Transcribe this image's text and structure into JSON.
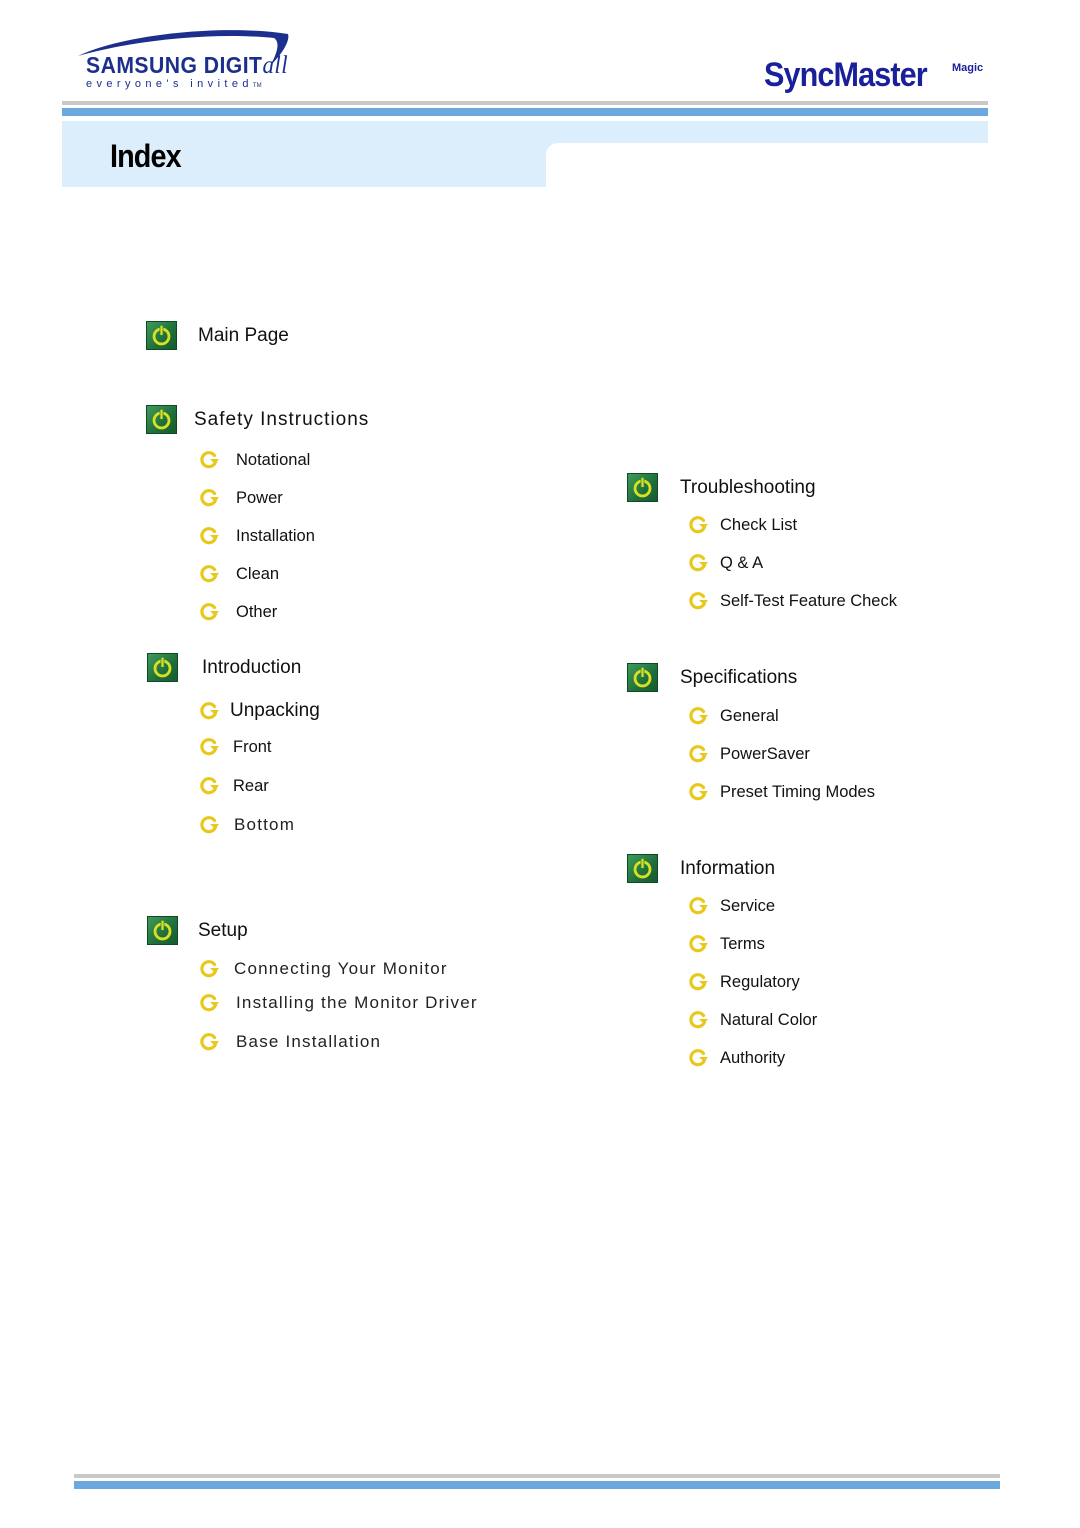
{
  "header": {
    "brand_left": {
      "name": "SAMSUNG DIGIT",
      "suffix": "all",
      "tagline": "everyone's invited",
      "tm": "TM"
    },
    "brand_right": {
      "name": "SyncMaster",
      "suffix": "Magic"
    },
    "title": "Index"
  },
  "icons": {
    "section": "power-icon",
    "item": "arrow-bullet-icon"
  },
  "colors": {
    "brand_blue": "#1a1f9a",
    "bar_blue": "#6aa8de",
    "band_light_blue": "#dcedfb",
    "icon_green": "#1f6e3a",
    "icon_yellow": "#d9e021",
    "bullet_yellow": "#e8c81a"
  },
  "left_column": {
    "main_page": {
      "label": "Main Page"
    },
    "safety": {
      "label": "Safety Instructions",
      "items": [
        "Notational",
        "Power",
        "Installation",
        "Clean",
        "Other"
      ]
    },
    "introduction": {
      "label": "Introduction",
      "items": [
        "Unpacking",
        "Front",
        "Rear",
        "Bottom"
      ]
    },
    "setup": {
      "label": "Setup",
      "items": [
        "Connecting Your Monitor",
        "Installing the Monitor Driver",
        "Base Installation"
      ]
    }
  },
  "right_column": {
    "troubleshooting": {
      "label": "Troubleshooting",
      "items": [
        "Check List",
        "Q & A",
        "Self-Test Feature Check"
      ]
    },
    "specifications": {
      "label": "Specifications",
      "items": [
        "General",
        "PowerSaver",
        "Preset Timing Modes"
      ]
    },
    "information": {
      "label": "Information",
      "items": [
        "Service",
        "Terms",
        "Regulatory",
        "Natural Color",
        "Authority"
      ]
    }
  }
}
